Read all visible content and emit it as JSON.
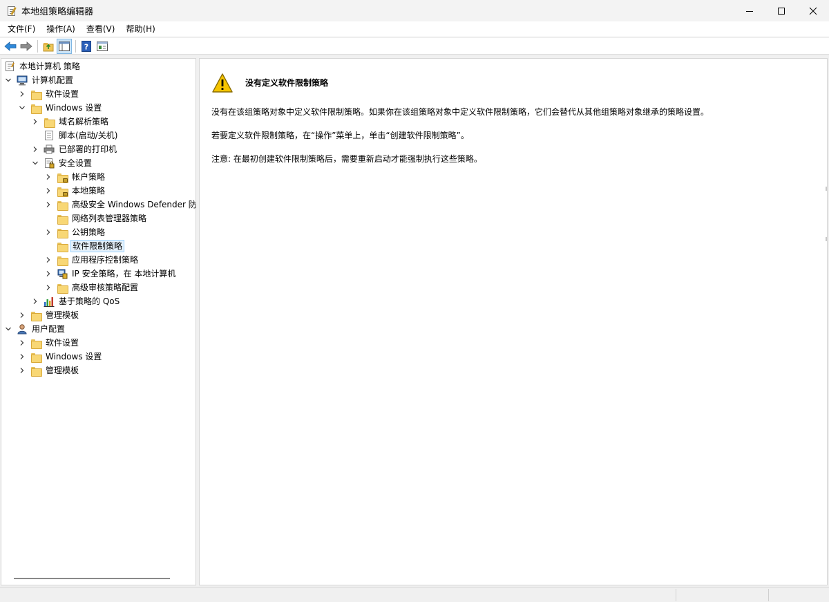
{
  "window": {
    "title": "本地组策略编辑器",
    "icon": "policy-editor-icon"
  },
  "window_controls": [
    "minimize-icon",
    "maximize-icon",
    "close-icon"
  ],
  "menu": [
    "文件(F)",
    "操作(A)",
    "查看(V)",
    "帮助(H)"
  ],
  "toolbar": [
    "back-arrow-icon",
    "forward-arrow-icon",
    "up-folder-icon",
    "show-hide-tree-icon",
    "help-icon",
    "properties-pane-icon"
  ],
  "tree": {
    "root": "本地计算机 策略",
    "computer_config": "计算机配置",
    "software_settings": "软件设置",
    "windows_settings": "Windows 设置",
    "name_resolution": "域名解析策略",
    "scripts": "脚本(启动/关机)",
    "printers": "已部署的打印机",
    "security_settings": "安全设置",
    "account_policies": "帐户策略",
    "local_policies": "本地策略",
    "firewall": "高级安全 Windows Defender 防",
    "network_list": "网络列表管理器策略",
    "public_key": "公钥策略",
    "software_restriction": "软件限制策略",
    "app_control": "应用程序控制策略",
    "ipsec": "IP 安全策略，在 本地计算机",
    "audit": "高级审核策略配置",
    "qos": "基于策略的 QoS",
    "admin_templates": "管理模板",
    "user_config": "用户配置",
    "user_software_settings": "软件设置",
    "user_windows_settings": "Windows 设置",
    "user_admin_templates": "管理模板"
  },
  "content": {
    "heading": "没有定义软件限制策略",
    "p1": "没有在该组策略对象中定义软件限制策略。如果你在该组策略对象中定义软件限制策略，它们会替代从其他组策略对象继承的策略设置。",
    "p2": "若要定义软件限制策略，在“操作”菜单上，单击“创建软件限制策略”。",
    "p3": "注意: 在最初创建软件限制策略后，需要重新启动才能强制执行这些策略。"
  },
  "colors": {
    "selection_bg": "#e5f1fb",
    "selection_border": "#99d1ff",
    "warning_yellow": "#f5c400",
    "folder": "#f8d775"
  }
}
